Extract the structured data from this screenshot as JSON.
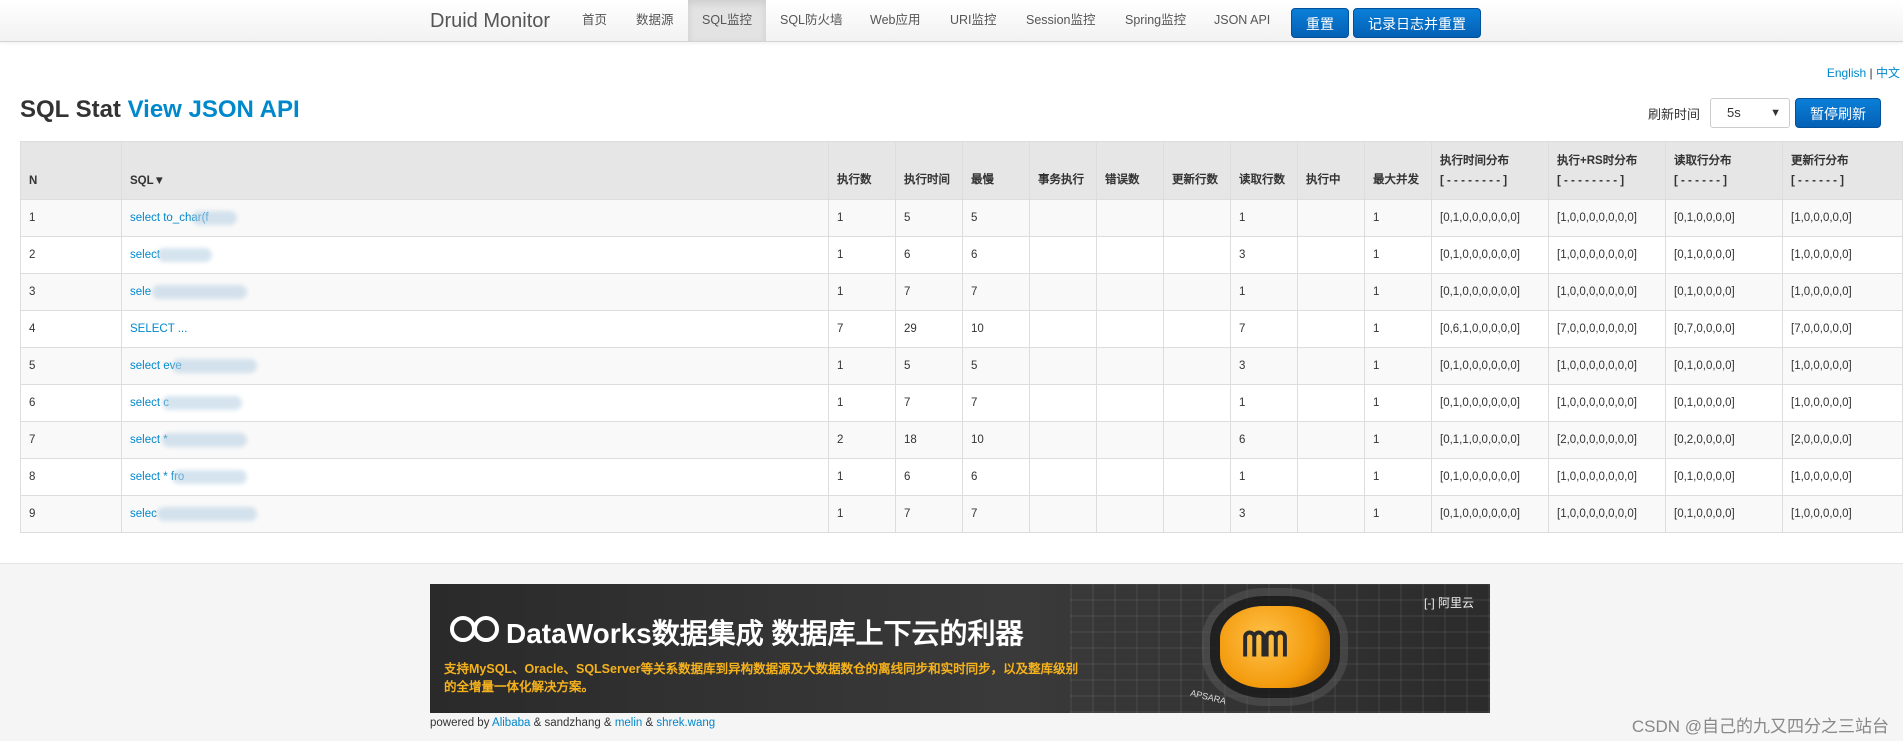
{
  "nav": {
    "brand": "Druid Monitor",
    "items": [
      {
        "label": "首页"
      },
      {
        "label": "数据源"
      },
      {
        "label": "SQL监控"
      },
      {
        "label": "SQL防火墙"
      },
      {
        "label": "Web应用"
      },
      {
        "label": "URI监控"
      },
      {
        "label": "Session监控"
      },
      {
        "label": "Spring监控"
      },
      {
        "label": "JSON API"
      }
    ],
    "active_item": "SQL监控",
    "reset_label": "重置",
    "log_reset_label": "记录日志并重置"
  },
  "lang": {
    "english": "English",
    "sep": " | ",
    "chinese": "中文"
  },
  "header": {
    "title": "SQL Stat ",
    "api_link": "View JSON API"
  },
  "refresh": {
    "label": "刷新时间",
    "value": "5s",
    "pause_label": "暂停刷新"
  },
  "table": {
    "columns": [
      "N",
      "SQL▼",
      "执行数",
      "执行时间",
      "最慢",
      "事务执行",
      "错误数",
      "更新行数",
      "读取行数",
      "执行中",
      "最大并发"
    ],
    "dist_columns": [
      {
        "label": "执行时间分布",
        "sub": "[ - - - - - - - - ]"
      },
      {
        "label": "执行+RS时分布",
        "sub": "[ - - - - - - - - ]"
      },
      {
        "label": "读取行分布",
        "sub": "[ - - - - - - ]"
      },
      {
        "label": "更新行分布",
        "sub": "[ - - - - - - ]"
      }
    ],
    "rows": [
      {
        "n": "1",
        "sql": "select to_char(f",
        "exec": "1",
        "time": "5",
        "slowest": "5",
        "tx": "",
        "err": "",
        "upd": "",
        "read": "1",
        "running": "",
        "conc": "1",
        "d1": "[0,1,0,0,0,0,0,0]",
        "d2": "[1,0,0,0,0,0,0,0]",
        "d3": "[0,1,0,0,0,0]",
        "d4": "[1,0,0,0,0,0]"
      },
      {
        "n": "2",
        "sql": "select",
        "exec": "1",
        "time": "6",
        "slowest": "6",
        "tx": "",
        "err": "",
        "upd": "",
        "read": "3",
        "running": "",
        "conc": "1",
        "d1": "[0,1,0,0,0,0,0,0]",
        "d2": "[1,0,0,0,0,0,0,0]",
        "d3": "[0,1,0,0,0,0]",
        "d4": "[1,0,0,0,0,0]"
      },
      {
        "n": "3",
        "sql": "sele",
        "exec": "1",
        "time": "7",
        "slowest": "7",
        "tx": "",
        "err": "",
        "upd": "",
        "read": "1",
        "running": "",
        "conc": "1",
        "d1": "[0,1,0,0,0,0,0,0]",
        "d2": "[1,0,0,0,0,0,0,0]",
        "d3": "[0,1,0,0,0,0]",
        "d4": "[1,0,0,0,0,0]"
      },
      {
        "n": "4",
        "sql": "SELECT ...",
        "exec": "7",
        "time": "29",
        "slowest": "10",
        "tx": "",
        "err": "",
        "upd": "",
        "read": "7",
        "running": "",
        "conc": "1",
        "d1": "[0,6,1,0,0,0,0,0]",
        "d2": "[7,0,0,0,0,0,0,0]",
        "d3": "[0,7,0,0,0,0]",
        "d4": "[7,0,0,0,0,0]"
      },
      {
        "n": "5",
        "sql": "select eve",
        "exec": "1",
        "time": "5",
        "slowest": "5",
        "tx": "",
        "err": "",
        "upd": "",
        "read": "3",
        "running": "",
        "conc": "1",
        "d1": "[0,1,0,0,0,0,0,0]",
        "d2": "[1,0,0,0,0,0,0,0]",
        "d3": "[0,1,0,0,0,0]",
        "d4": "[1,0,0,0,0,0]"
      },
      {
        "n": "6",
        "sql": "select c",
        "exec": "1",
        "time": "7",
        "slowest": "7",
        "tx": "",
        "err": "",
        "upd": "",
        "read": "1",
        "running": "",
        "conc": "1",
        "d1": "[0,1,0,0,0,0,0,0]",
        "d2": "[1,0,0,0,0,0,0,0]",
        "d3": "[0,1,0,0,0,0]",
        "d4": "[1,0,0,0,0,0]"
      },
      {
        "n": "7",
        "sql": "select *",
        "exec": "2",
        "time": "18",
        "slowest": "10",
        "tx": "",
        "err": "",
        "upd": "",
        "read": "6",
        "running": "",
        "conc": "1",
        "d1": "[0,1,1,0,0,0,0,0]",
        "d2": "[2,0,0,0,0,0,0,0]",
        "d3": "[0,2,0,0,0,0]",
        "d4": "[2,0,0,0,0,0]"
      },
      {
        "n": "8",
        "sql": "select * fro",
        "exec": "1",
        "time": "6",
        "slowest": "6",
        "tx": "",
        "err": "",
        "upd": "",
        "read": "1",
        "running": "",
        "conc": "1",
        "d1": "[0,1,0,0,0,0,0,0]",
        "d2": "[1,0,0,0,0,0,0,0]",
        "d3": "[0,1,0,0,0,0]",
        "d4": "[1,0,0,0,0,0]"
      },
      {
        "n": "9",
        "sql": "selec",
        "exec": "1",
        "time": "7",
        "slowest": "7",
        "tx": "",
        "err": "",
        "upd": "",
        "read": "3",
        "running": "",
        "conc": "1",
        "d1": "[0,1,0,0,0,0,0,0]",
        "d2": "[1,0,0,0,0,0,0,0]",
        "d3": "[0,1,0,0,0,0]",
        "d4": "[1,0,0,0,0,0]"
      }
    ]
  },
  "banner": {
    "headline": "DataWorks数据集成 数据库上下云的利器",
    "sub": "支持MySQL、Oracle、SQLServer等关系数据库到异构数据源及大数据数仓的离线同步和实时同步，以及整库级别的全增量一体化解决方案。",
    "brand": "阿里云",
    "apsara": "APSARA"
  },
  "footer": {
    "powered_by": "powered by",
    "alibaba": "Alibaba",
    "amp1": " & sandzhang & ",
    "melin": "melin",
    "amp2": " & ",
    "shrek": "shrek.wang"
  },
  "watermark": "CSDN @自己的九又四分之三站台"
}
